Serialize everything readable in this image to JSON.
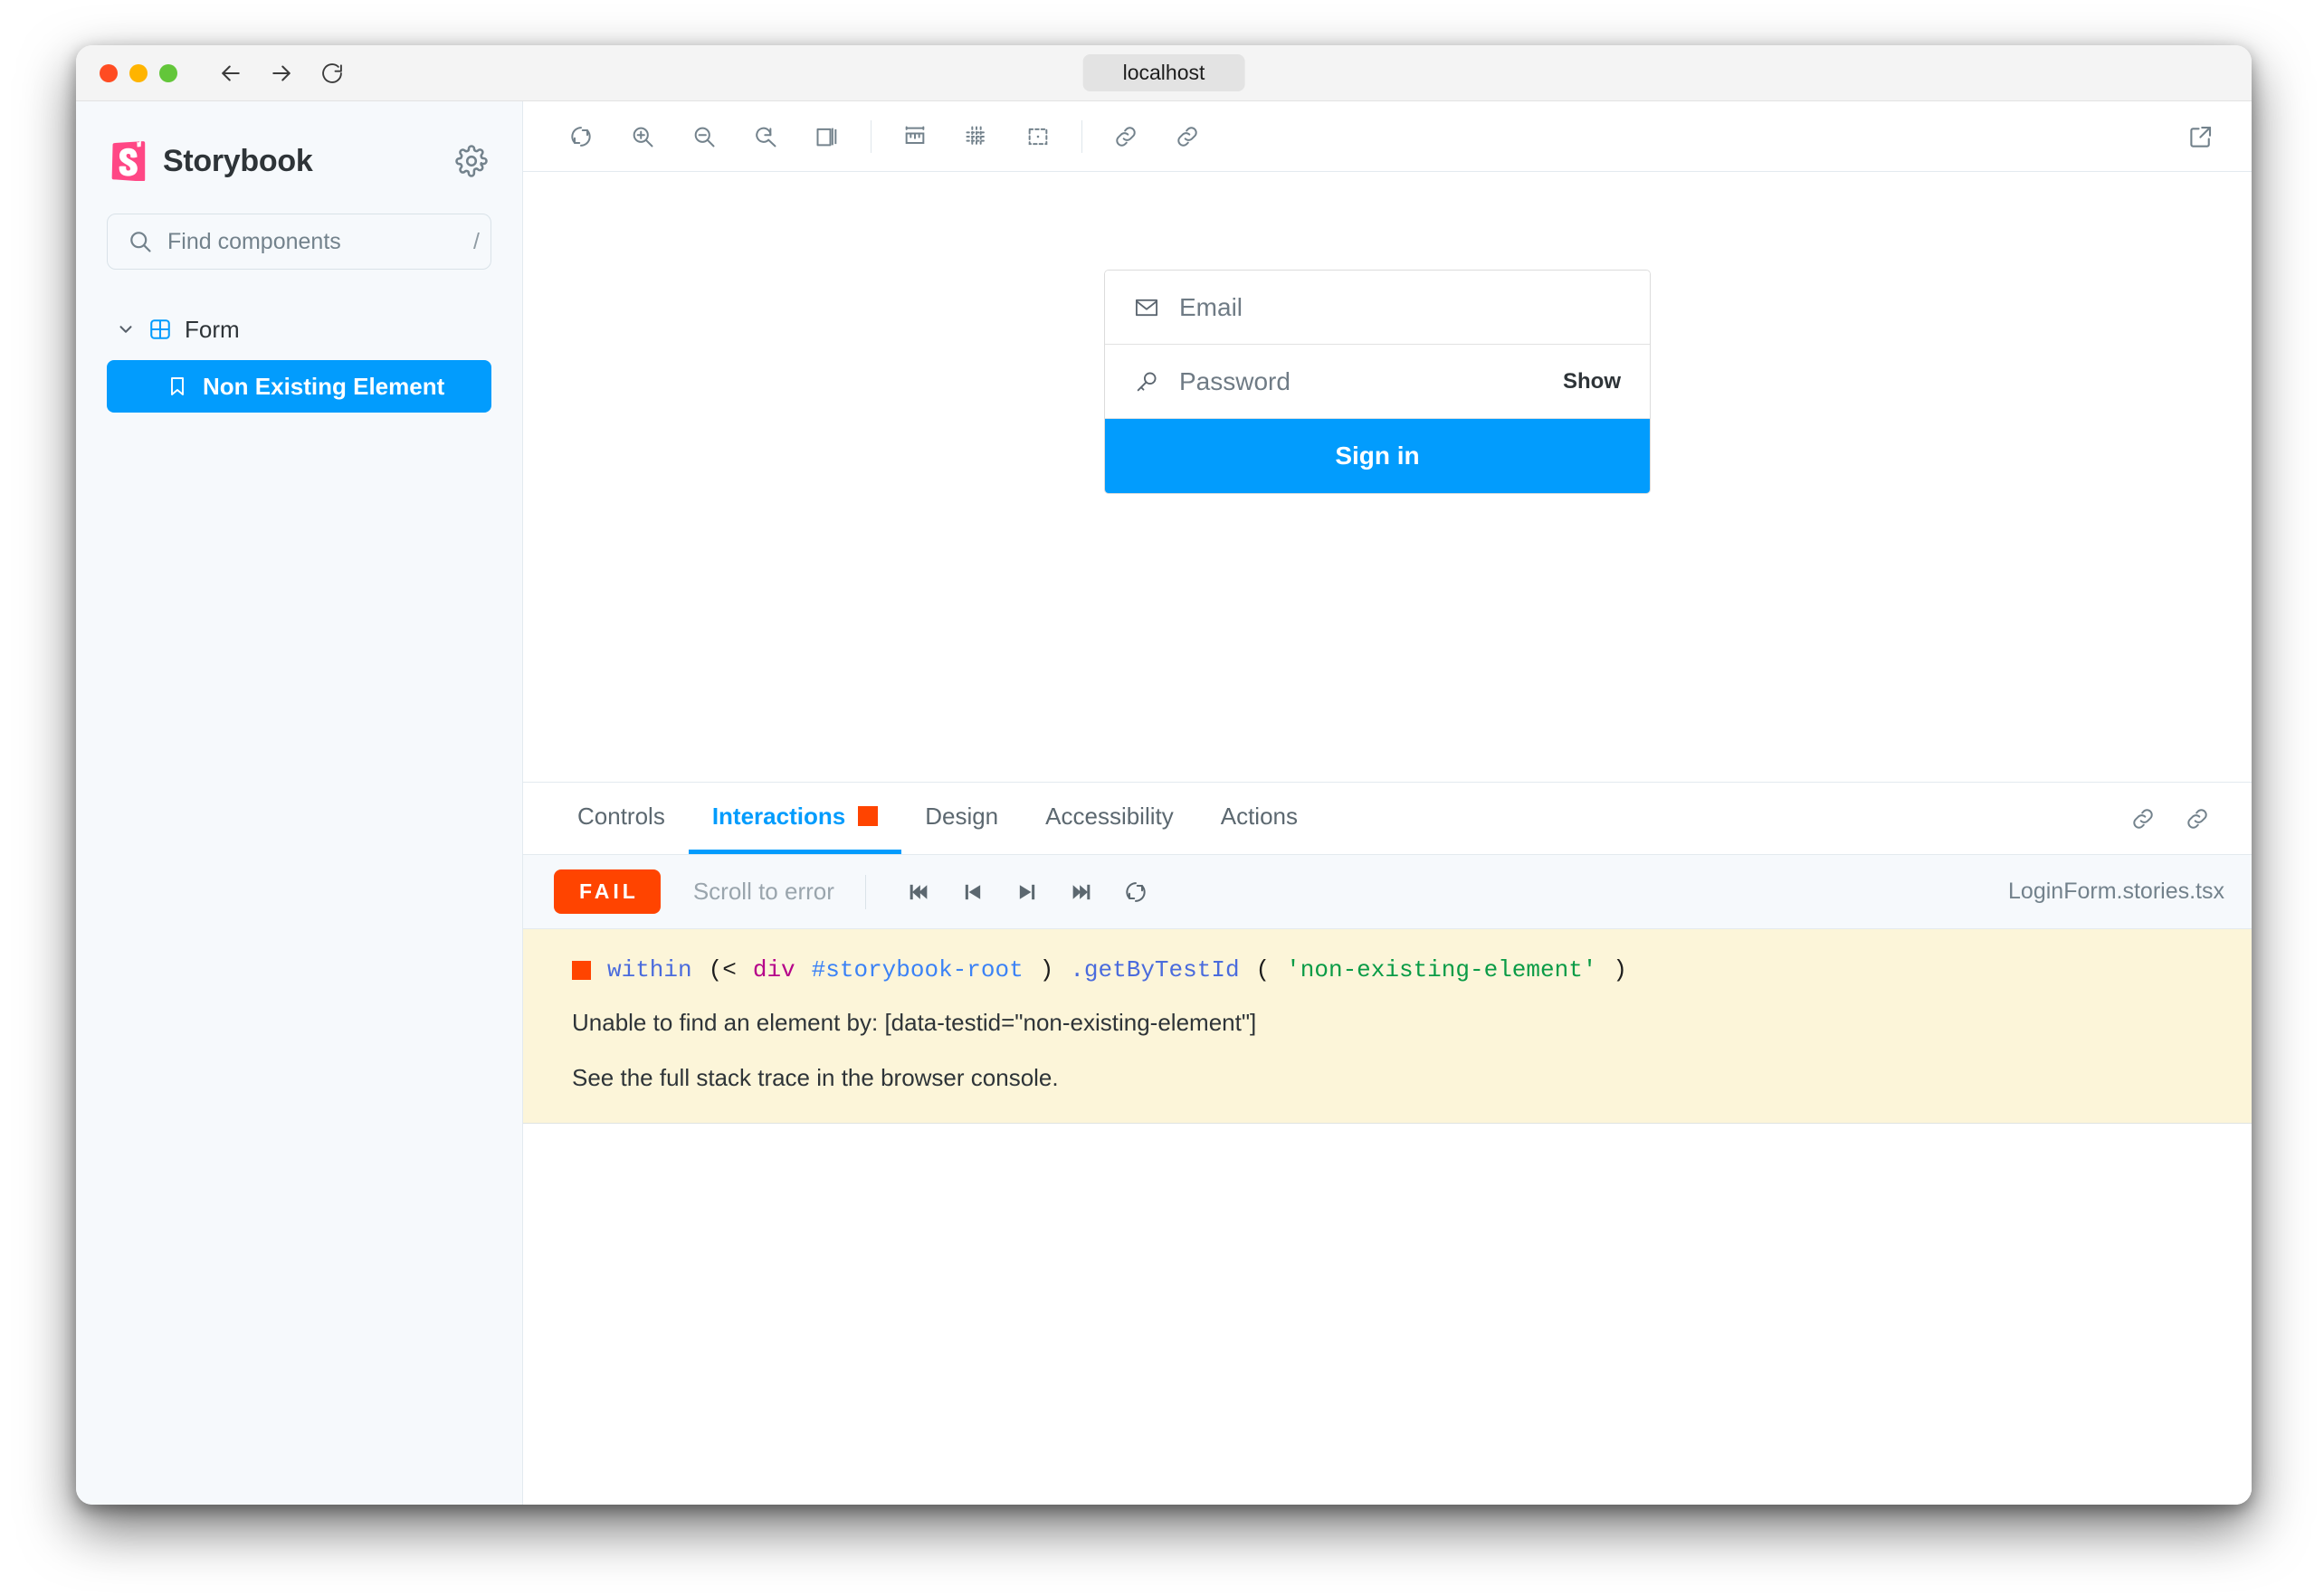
{
  "browser": {
    "url_label": "localhost",
    "back_icon": "arrow-left-icon",
    "forward_icon": "arrow-right-icon",
    "reload_icon": "reload-icon",
    "traffic_lights": [
      "close-red",
      "minimize-yellow",
      "maximize-green"
    ]
  },
  "sidebar": {
    "brand": "Storybook",
    "settings_icon": "gear-icon",
    "search": {
      "placeholder": "Find components",
      "value": "",
      "shortcut": "/",
      "icon": "search-icon"
    },
    "tree": {
      "group": {
        "label": "Form",
        "expanded": true,
        "chevron_icon": "chevron-down-icon",
        "component_icon": "component-grid-icon"
      },
      "items": [
        {
          "label": "Non Existing Element",
          "icon": "bookmark-icon",
          "selected": true
        }
      ]
    }
  },
  "preview_toolbar": {
    "buttons": [
      {
        "name": "remount-button",
        "icon": "reload-circular-icon",
        "title": "Remount component"
      },
      {
        "name": "zoom-in-button",
        "icon": "zoom-in-icon",
        "title": "Zoom in"
      },
      {
        "name": "zoom-out-button",
        "icon": "zoom-out-icon",
        "title": "Zoom out"
      },
      {
        "name": "zoom-reset-button",
        "icon": "zoom-reset-icon",
        "title": "Reset zoom"
      },
      {
        "name": "background-button",
        "icon": "copy-layers-icon",
        "title": "Change background"
      },
      {
        "name": "measure-button",
        "icon": "ruler-icon",
        "title": "Enable measure"
      },
      {
        "name": "grid-button",
        "icon": "grid-dots-icon",
        "title": "Apply grid"
      },
      {
        "name": "outline-button",
        "icon": "outline-box-icon",
        "title": "Apply outlines"
      },
      {
        "name": "copy-link-button",
        "icon": "link-icon",
        "title": "Copy canvas link"
      },
      {
        "name": "share-link-button",
        "icon": "link-icon",
        "title": "Share link"
      }
    ],
    "open_new_tab_icon": "external-link-icon"
  },
  "story": {
    "form": {
      "email": {
        "placeholder": "Email",
        "value": "",
        "icon": "envelope-icon"
      },
      "password": {
        "placeholder": "Password",
        "value": "",
        "icon": "key-icon",
        "show_label": "Show"
      },
      "submit_label": "Sign in"
    }
  },
  "panel": {
    "tabs": [
      {
        "label": "Controls",
        "active": false,
        "badge": null
      },
      {
        "label": "Interactions",
        "active": true,
        "badge": "error-square"
      },
      {
        "label": "Design",
        "active": false,
        "badge": null
      },
      {
        "label": "Accessibility",
        "active": false,
        "badge": null
      },
      {
        "label": "Actions",
        "active": false,
        "badge": null
      }
    ],
    "tab_icons": [
      "link-icon",
      "link-icon"
    ],
    "interactions": {
      "status": "FAIL",
      "scroll_to_error_label": "Scroll to error",
      "controls": [
        {
          "name": "go-to-start-button",
          "icon": "skip-to-start-icon"
        },
        {
          "name": "step-back-button",
          "icon": "step-back-icon"
        },
        {
          "name": "step-forward-button",
          "icon": "step-forward-icon"
        },
        {
          "name": "go-to-end-button",
          "icon": "skip-to-end-icon"
        },
        {
          "name": "rerun-button",
          "icon": "reload-circular-icon"
        }
      ],
      "story_file": "LoginForm.stories.tsx",
      "error": {
        "call": {
          "fn": "within",
          "open": "(<",
          "tag": "div",
          "selector": "#storybook-root",
          "close_paren": ")",
          "method": ".getByTestId",
          "arg_open": "(",
          "arg": "'non-existing-element'",
          "arg_close": ")"
        },
        "message": "Unable to find an element by: [data-testid=\"non-existing-element\"]",
        "hint": "See the full stack trace in the browser console."
      }
    }
  },
  "colors": {
    "storybook_blue": "#029CFD",
    "storybook_pink": "#FF4785",
    "fail_orange": "#FF4400",
    "error_bg": "#FCF5D9",
    "sidebar_bg": "#F6F9FC"
  }
}
